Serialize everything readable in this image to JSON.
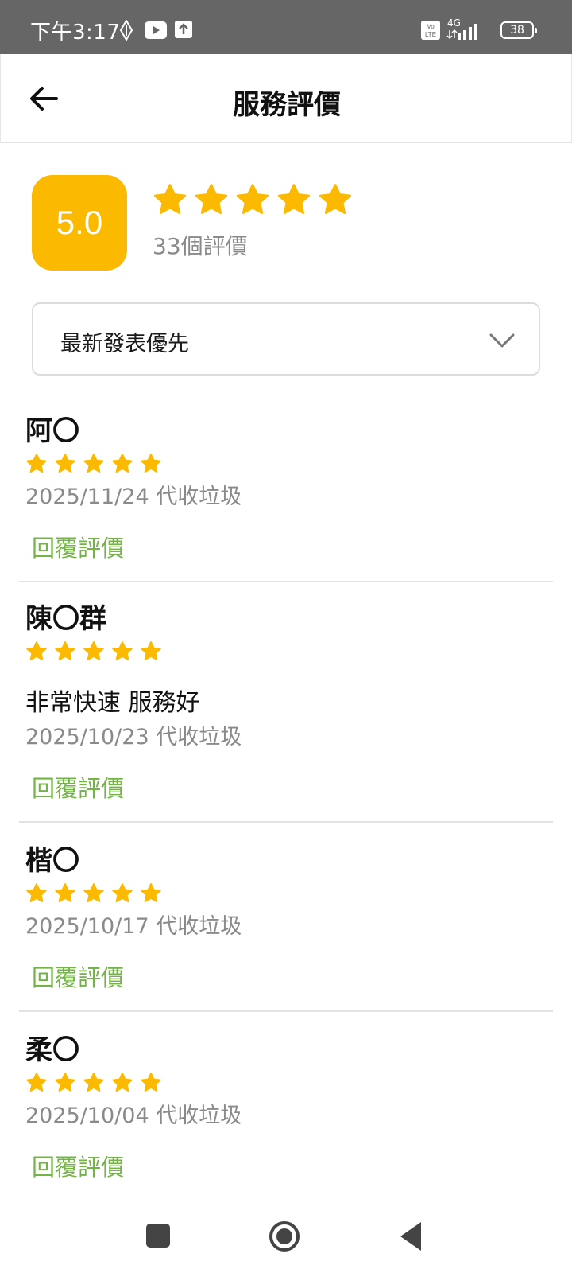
{
  "status_bar": {
    "time": "下午3:17",
    "battery": "38",
    "network": "4G"
  },
  "header": {
    "title": "服務評價"
  },
  "summary": {
    "rating": "5.0",
    "stars": 5,
    "count_label": "33個評價"
  },
  "sort": {
    "selected": "最新發表優先"
  },
  "reviews": [
    {
      "name": "阿〇",
      "stars": 5,
      "text": "",
      "date": "2025/11/24",
      "service": "代收垃圾",
      "reply_label": "回覆評價"
    },
    {
      "name": "陳〇群",
      "stars": 5,
      "text": "非常快速 服務好",
      "date": "2025/10/23",
      "service": "代收垃圾",
      "reply_label": "回覆評價"
    },
    {
      "name": "楷〇",
      "stars": 5,
      "text": "",
      "date": "2025/10/17",
      "service": "代收垃圾",
      "reply_label": "回覆評價"
    },
    {
      "name": "柔〇",
      "stars": 5,
      "text": "",
      "date": "2025/10/04",
      "service": "代收垃圾",
      "reply_label": "回覆評價"
    }
  ],
  "colors": {
    "star": "#fbb900",
    "reply": "#72b544",
    "badge": "#fbb900"
  },
  "icons": [
    "back-arrow-icon",
    "chevron-down-icon",
    "star-icon",
    "nav-recents-icon",
    "nav-home-icon",
    "nav-back-icon"
  ]
}
